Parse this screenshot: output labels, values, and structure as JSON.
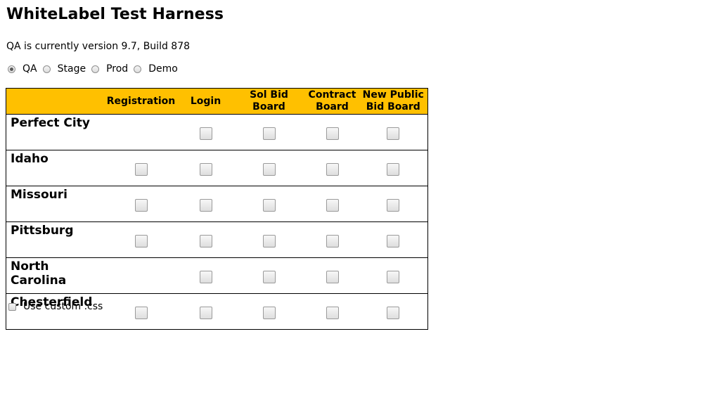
{
  "title": "WhiteLabel Test Harness",
  "version_text": "QA is currently version 9.7, Build 878",
  "environments": [
    {
      "label": "QA",
      "selected": true
    },
    {
      "label": "Stage",
      "selected": false
    },
    {
      "label": "Prod",
      "selected": false
    },
    {
      "label": "Demo",
      "selected": false
    }
  ],
  "table": {
    "header_color": "#ffc000",
    "columns": [
      "",
      "Registration",
      "Login",
      "Sol Bid Board",
      "Contract Board",
      "New Public Bid Board"
    ],
    "rows": [
      {
        "label": "Perfect City",
        "registration": false,
        "login": true,
        "sol_bid_board": true,
        "contract_board": true,
        "new_public_bid_board": true
      },
      {
        "label": "Idaho",
        "registration": true,
        "login": true,
        "sol_bid_board": true,
        "contract_board": true,
        "new_public_bid_board": true
      },
      {
        "label": "Missouri",
        "registration": true,
        "login": true,
        "sol_bid_board": true,
        "contract_board": true,
        "new_public_bid_board": true
      },
      {
        "label": "Pittsburg",
        "registration": true,
        "login": true,
        "sol_bid_board": true,
        "contract_board": true,
        "new_public_bid_board": true
      },
      {
        "label": "North Carolina",
        "registration": false,
        "login": true,
        "sol_bid_board": true,
        "contract_board": true,
        "new_public_bid_board": true
      },
      {
        "label": "Chesterfield",
        "registration": true,
        "login": true,
        "sol_bid_board": true,
        "contract_board": true,
        "new_public_bid_board": true
      }
    ]
  },
  "custom_css_label": "Use custom .css"
}
